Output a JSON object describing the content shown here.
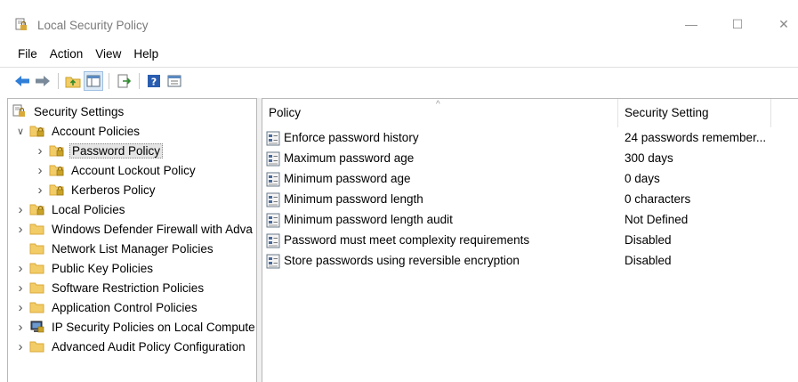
{
  "window": {
    "title": "Local Security Policy",
    "minimize_glyph": "—",
    "maximize_glyph": "☐",
    "close_glyph": "✕"
  },
  "menu": [
    "File",
    "Action",
    "View",
    "Help"
  ],
  "toolbar": {
    "buttons": [
      "back-arrow-icon",
      "forward-arrow-icon",
      "up-folder-icon",
      "show-hide-tree-icon",
      "export-list-icon",
      "help-icon",
      "properties-icon"
    ]
  },
  "tree": {
    "root": "Security Settings",
    "items": [
      {
        "label": "Account Policies",
        "level": 1,
        "expander": "expanded",
        "icon": "folder-lock-icon"
      },
      {
        "label": "Password Policy",
        "level": 2,
        "expander": "collapsed",
        "icon": "folder-lock-icon",
        "selected": true
      },
      {
        "label": "Account Lockout Policy",
        "level": 2,
        "expander": "collapsed",
        "icon": "folder-lock-icon"
      },
      {
        "label": "Kerberos Policy",
        "level": 2,
        "expander": "collapsed",
        "icon": "folder-lock-icon"
      },
      {
        "label": "Local Policies",
        "level": 1,
        "expander": "collapsed",
        "icon": "folder-lock-icon"
      },
      {
        "label": "Windows Defender Firewall with Adva",
        "level": 1,
        "expander": "collapsed",
        "icon": "folder-icon"
      },
      {
        "label": "Network List Manager Policies",
        "level": 1,
        "expander": "none",
        "icon": "folder-icon"
      },
      {
        "label": "Public Key Policies",
        "level": 1,
        "expander": "collapsed",
        "icon": "folder-icon"
      },
      {
        "label": "Software Restriction Policies",
        "level": 1,
        "expander": "collapsed",
        "icon": "folder-icon"
      },
      {
        "label": "Application Control Policies",
        "level": 1,
        "expander": "collapsed",
        "icon": "folder-icon"
      },
      {
        "label": "IP Security Policies on Local Compute",
        "level": 1,
        "expander": "collapsed",
        "icon": "ip-security-icon"
      },
      {
        "label": "Advanced Audit Policy Configuration",
        "level": 1,
        "expander": "collapsed",
        "icon": "folder-icon"
      }
    ]
  },
  "list": {
    "columns": {
      "policy": "Policy",
      "setting": "Security Setting"
    },
    "rows": [
      {
        "policy": "Enforce password history",
        "setting": "24 passwords remember...",
        "icon": "policy-icon"
      },
      {
        "policy": "Maximum password age",
        "setting": "300 days",
        "icon": "policy-icon"
      },
      {
        "policy": "Minimum password age",
        "setting": "0 days",
        "icon": "policy-icon"
      },
      {
        "policy": "Minimum password length",
        "setting": "0 characters",
        "icon": "policy-icon"
      },
      {
        "policy": "Minimum password length audit",
        "setting": "Not Defined",
        "icon": "policy-icon"
      },
      {
        "policy": "Password must meet complexity requirements",
        "setting": "Disabled",
        "icon": "policy-icon"
      },
      {
        "policy": "Store passwords using reversible encryption",
        "setting": "Disabled",
        "icon": "policy-icon"
      }
    ]
  },
  "colors": {
    "folder": "#f2cc66",
    "folder_dark": "#d9a93a",
    "lock": "#c9a227",
    "arrow": "#2f7fd8",
    "selection": "#e5e5e5"
  }
}
